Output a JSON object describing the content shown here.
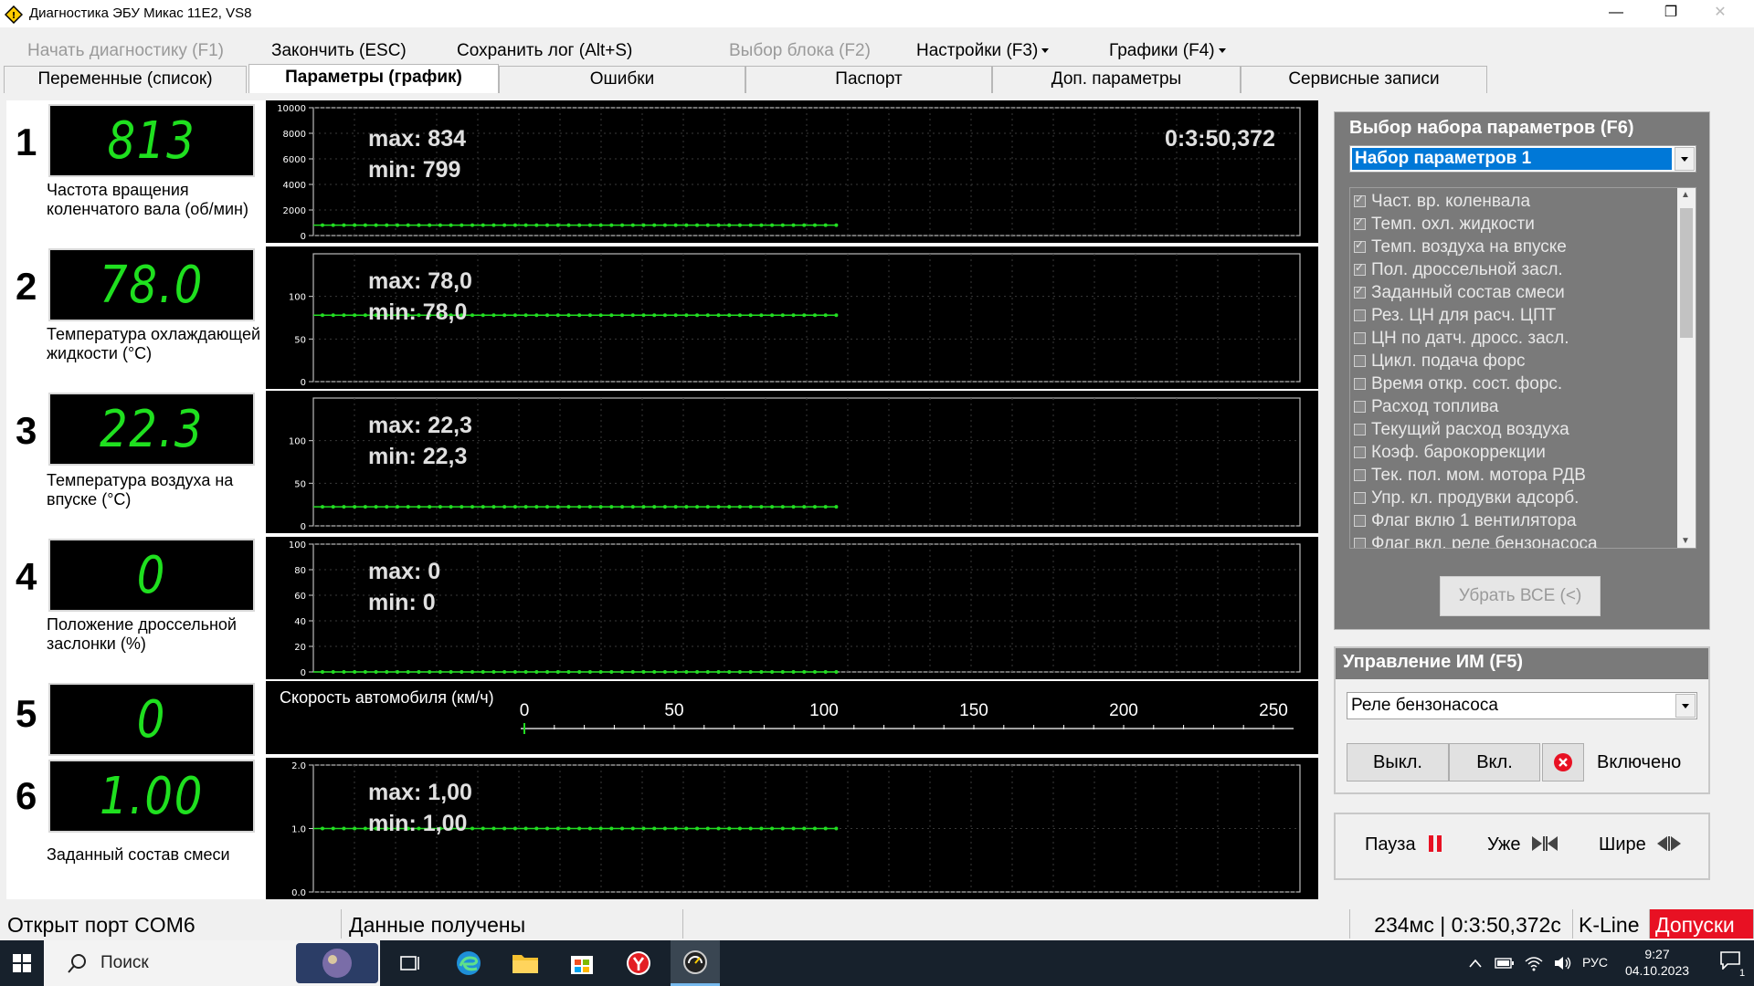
{
  "window": {
    "title": "Диагностика ЭБУ Микас 11Е2, VS8",
    "minimize": "—",
    "maximize": "❐",
    "close": "✕"
  },
  "menu": {
    "start": "Начать диагностику (F1)",
    "stop": "Закончить (ESC)",
    "save_log": "Сохранить лог (Alt+S)",
    "select_block": "Выбор блока (F2)",
    "settings": "Настройки (F3)",
    "graphs": "Графики (F4)"
  },
  "tabs": [
    {
      "label": "Переменные (список)"
    },
    {
      "label": "Параметры (график)"
    },
    {
      "label": "Ошибки"
    },
    {
      "label": "Паспорт"
    },
    {
      "label": "Доп. параметры"
    },
    {
      "label": "Сервисные записи"
    }
  ],
  "rows": [
    {
      "num": "1",
      "value": "813",
      "label": "Частота вращения коленчатого вала (об/мин)",
      "max": "max: 834",
      "min": "min: 799",
      "time": "0:3:50,372",
      "y_ticks": [
        "10000",
        "8000",
        "6000",
        "4000",
        "2000",
        "0"
      ]
    },
    {
      "num": "2",
      "value": "78.0",
      "label": "Температура охлаждающей жидкости (°C)",
      "max": "max: 78,0",
      "min": "min: 78,0",
      "y_ticks": [
        "100",
        "50",
        "0"
      ]
    },
    {
      "num": "3",
      "value": "22.3",
      "label": "Температура воздуха на впуске (°C)",
      "max": "max: 22,3",
      "min": "min: 22,3",
      "y_ticks": [
        "100",
        "50",
        "0"
      ]
    },
    {
      "num": "4",
      "value": "0",
      "label": "Положение дроссельной заслонки (%)",
      "max": "max: 0",
      "min": "min: 0",
      "y_ticks": [
        "100",
        "80",
        "60",
        "40",
        "20",
        "0"
      ]
    },
    {
      "num": "5",
      "value": "0",
      "speed_title": "Скорость автомобиля (км/ч)",
      "scale_labels": [
        "0",
        "50",
        "100",
        "150",
        "200",
        "250"
      ]
    },
    {
      "num": "6",
      "value": "1.00",
      "label": "Заданный состав смеси",
      "max": "max: 1,00",
      "min": "min: 1,00",
      "y_ticks": [
        "2.0",
        "1.0",
        "0.0"
      ]
    }
  ],
  "chart_data": [
    {
      "type": "line",
      "title": "Частота вращения коленчатого вала (об/мин)",
      "ylim": [
        0,
        10000
      ],
      "series": [
        {
          "values_level": 813
        }
      ]
    },
    {
      "type": "line",
      "title": "Температура охлаждающей жидкости (°C)",
      "ylim": [
        0,
        150
      ],
      "series": [
        {
          "values_level": 78.0
        }
      ]
    },
    {
      "type": "line",
      "title": "Температура воздуха на впуске (°C)",
      "ylim": [
        0,
        150
      ],
      "series": [
        {
          "values_level": 22.3
        }
      ]
    },
    {
      "type": "line",
      "title": "Положение дроссельной заслонки (%)",
      "ylim": [
        0,
        100
      ],
      "series": [
        {
          "values_level": 0
        }
      ]
    },
    {
      "type": "bar",
      "title": "Скорость автомобиля (км/ч)",
      "xlim": [
        0,
        250
      ],
      "values": [
        0
      ]
    },
    {
      "type": "line",
      "title": "Заданный состав смеси",
      "ylim": [
        0,
        2.0
      ],
      "series": [
        {
          "values_level": 1.0
        }
      ]
    }
  ],
  "param_set": {
    "title": "Выбор набора параметров (F6)",
    "selected": "Набор параметров 1",
    "items": [
      {
        "label": "Част. вр. коленвала",
        "checked": true
      },
      {
        "label": "Темп. охл. жидкости",
        "checked": true
      },
      {
        "label": "Темп. воздуха на впуске",
        "checked": true
      },
      {
        "label": "Пол. дроссельной засл.",
        "checked": true
      },
      {
        "label": "Заданный состав смеси",
        "checked": true
      },
      {
        "label": "Рез. ЦН для расч. ЦПТ",
        "checked": false
      },
      {
        "label": "ЦН по датч. дросс. засл.",
        "checked": false
      },
      {
        "label": "Цикл. подача форс",
        "checked": false
      },
      {
        "label": "Время откр. сост. форс.",
        "checked": false
      },
      {
        "label": "Расход топлива",
        "checked": false
      },
      {
        "label": "Текущий расход воздуха",
        "checked": false
      },
      {
        "label": "Коэф. барокоррекции",
        "checked": false
      },
      {
        "label": "Тек. пол. мом. мотора РДВ",
        "checked": false
      },
      {
        "label": "Упр. кл. продувки адсорб.",
        "checked": false
      },
      {
        "label": "Флаг вклю 1 вентилятора",
        "checked": false
      },
      {
        "label": "Флаг вкл. реле бензонасоса",
        "checked": false
      }
    ],
    "remove_all": "Убрать ВСЕ (<)"
  },
  "actuator": {
    "title": "Управление ИМ (F5)",
    "selected": "Реле бензонасоса",
    "off": "Выкл.",
    "on": "Вкл.",
    "status": "Включено"
  },
  "playback": {
    "pause": "Пауза",
    "narrow": "Уже",
    "wide": "Шире"
  },
  "status": {
    "port": "Открыт порт COM6",
    "data": "Данные получены",
    "timing": "234мс | 0:3:50,372с",
    "protocol": "K-Line",
    "tolerances": "Допуски",
    "tolerances_color": "#e81123"
  },
  "taskbar": {
    "search": "Поиск",
    "lang": "РУС",
    "time": "9:27",
    "date": "04.10.2023",
    "notifications": "1"
  },
  "colors": {
    "lcd_text": "#1fe01f",
    "plot_line": "#22dd22",
    "chart_bg": "#000000",
    "accent": "#0078d7"
  }
}
